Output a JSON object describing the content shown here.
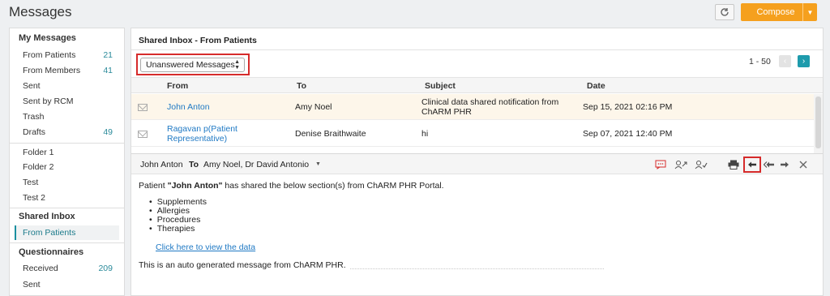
{
  "page": {
    "title": "Messages"
  },
  "toolbar": {
    "compose_label": "Compose"
  },
  "sidebar": {
    "sections": [
      {
        "heading": "My Messages"
      },
      {
        "heading": "Shared Inbox"
      },
      {
        "heading": "Questionnaires"
      }
    ],
    "my_messages": [
      {
        "label": "From Patients",
        "count": "21"
      },
      {
        "label": "From Members",
        "count": "41"
      },
      {
        "label": "Sent",
        "count": ""
      },
      {
        "label": "Sent by RCM",
        "count": ""
      },
      {
        "label": "Trash",
        "count": ""
      },
      {
        "label": "Drafts",
        "count": "49"
      }
    ],
    "folders": [
      {
        "label": "Folder 1"
      },
      {
        "label": "Folder 2"
      },
      {
        "label": "Test"
      },
      {
        "label": "Test 2"
      }
    ],
    "shared_inbox": [
      {
        "label": "From Patients",
        "active": true
      }
    ],
    "questionnaires": [
      {
        "label": "Received",
        "count": "209"
      },
      {
        "label": "Sent",
        "count": ""
      }
    ]
  },
  "inbox": {
    "title": "Shared Inbox - From Patients",
    "filter_value": "Unanswered Messages",
    "pager_text": "1 - 50",
    "columns": [
      "From",
      "To",
      "Subject",
      "Date"
    ],
    "rows": [
      {
        "from": "John Anton",
        "to": "Amy Noel",
        "subject": "Clinical data shared notification from ChARM PHR",
        "date": "Sep 15, 2021 02:16 PM",
        "selected": true
      },
      {
        "from": "Ragavan p(Patient Representative)",
        "to": "Denise Braithwaite",
        "subject": "hi",
        "date": "Sep 07, 2021 12:40 PM",
        "selected": false
      }
    ]
  },
  "preview": {
    "from": "John Anton",
    "to_label": "To",
    "to": "Amy Noel, Dr David Antonio",
    "body_intro_prefix": "Patient ",
    "body_intro_name": "\"John Anton\"",
    "body_intro_suffix": " has shared the below section(s) from ChARM PHR Portal.",
    "sections": [
      "Supplements",
      "Allergies",
      "Procedures",
      "Therapies"
    ],
    "view_link": "Click here to view the data",
    "footer": "This is an auto generated message from ChARM PHR."
  },
  "icons": {
    "refresh": "refresh-icon",
    "chat": "chat-icon",
    "assign": "assign-icon",
    "mark": "mark-icon",
    "print": "print-icon",
    "reply": "reply-icon",
    "reply_all": "reply-all-icon",
    "forward": "forward-icon",
    "close": "close-icon"
  },
  "colors": {
    "accent": "#1e9bac",
    "compose": "#f5a01e",
    "highlight": "#d62b2b",
    "link": "#1f79c4"
  }
}
